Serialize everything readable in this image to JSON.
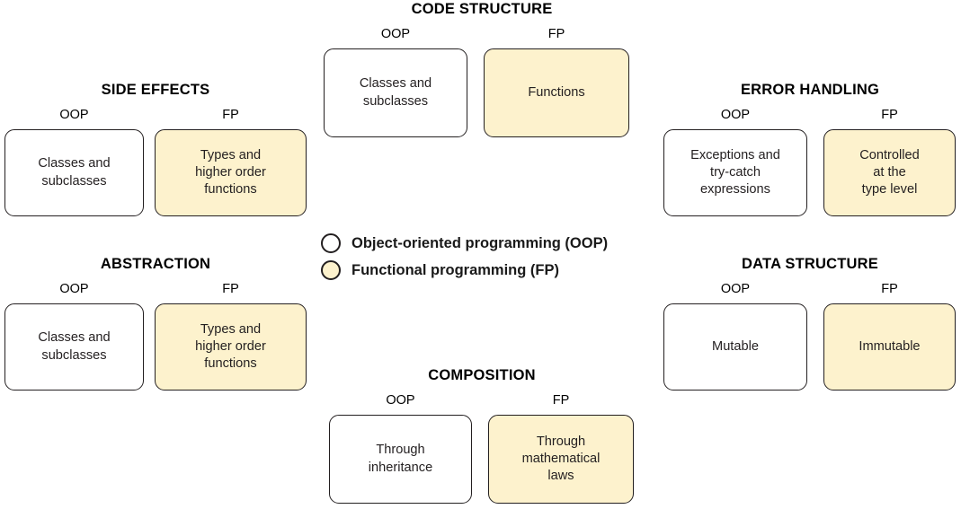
{
  "diagram": {
    "column_labels": {
      "oop": "OOP",
      "fp": "FP"
    },
    "legend": {
      "oop": {
        "label": "Object-oriented programming (OOP)",
        "color": "#ffffff"
      },
      "fp": {
        "label": "Functional programming (FP)",
        "color": "#fdf2cd"
      }
    },
    "sections": {
      "code_structure": {
        "title": "CODE STRUCTURE",
        "oop_label": "OOP",
        "fp_label": "FP",
        "oop_text": "Classes and\nsubclasses",
        "fp_text": "Functions"
      },
      "side_effects": {
        "title": "SIDE EFFECTS",
        "oop_label": "OOP",
        "fp_label": "FP",
        "oop_text": "Classes and\nsubclasses",
        "fp_text": "Types and\nhigher order\nfunctions"
      },
      "error_handling": {
        "title": "ERROR HANDLING",
        "oop_label": "OOP",
        "fp_label": "FP",
        "oop_text": "Exceptions and\ntry-catch\nexpressions",
        "fp_text": "Controlled\nat the\ntype level"
      },
      "abstraction": {
        "title": "ABSTRACTION",
        "oop_label": "OOP",
        "fp_label": "FP",
        "oop_text": "Classes and\nsubclasses",
        "fp_text": "Types and\nhigher order\nfunctions"
      },
      "data_structure": {
        "title": "DATA STRUCTURE",
        "oop_label": "OOP",
        "fp_label": "FP",
        "oop_text": "Mutable",
        "fp_text": "Immutable"
      },
      "composition": {
        "title": "COMPOSITION",
        "oop_label": "OOP",
        "fp_label": "FP",
        "oop_text": "Through\ninheritance",
        "fp_text": "Through\nmathematical\nlaws"
      }
    }
  }
}
